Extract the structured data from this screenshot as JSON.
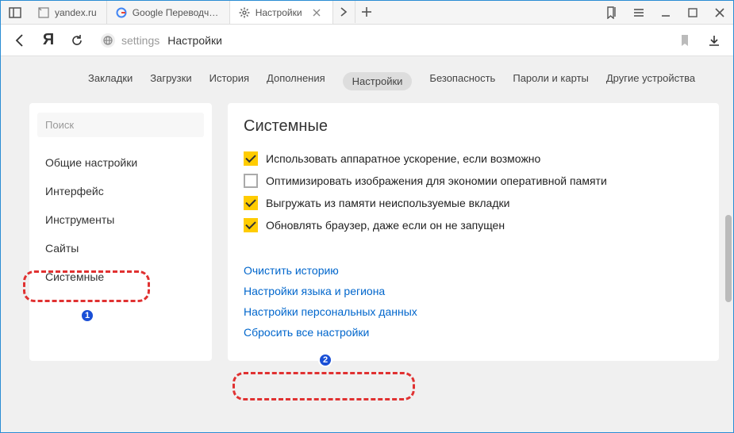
{
  "titlebar": {
    "tabs": [
      {
        "title": "yandex.ru",
        "favicon": "page"
      },
      {
        "title": "Google Переводчик - ",
        "favicon": "google"
      },
      {
        "title": "Настройки",
        "favicon": "gear",
        "active": true
      }
    ]
  },
  "addressbar": {
    "urlHint": "settings",
    "urlTitle": "Настройки"
  },
  "subnav": {
    "items": [
      "Закладки",
      "Загрузки",
      "История",
      "Дополнения",
      "Настройки",
      "Безопасность",
      "Пароли и карты",
      "Другие устройства"
    ],
    "activeIndex": 4
  },
  "sidebar": {
    "searchPlaceholder": "Поиск",
    "items": [
      "Общие настройки",
      "Интерфейс",
      "Инструменты",
      "Сайты",
      "Системные"
    ],
    "activeIndex": 4
  },
  "main": {
    "heading": "Системные",
    "options": [
      {
        "label": "Использовать аппаратное ускорение, если возможно",
        "checked": true
      },
      {
        "label": "Оптимизировать изображения для экономии оперативной памяти",
        "checked": false
      },
      {
        "label": "Выгружать из памяти неиспользуемые вкладки",
        "checked": true
      },
      {
        "label": "Обновлять браузер, даже если он не запущен",
        "checked": true
      }
    ],
    "links": [
      "Очистить историю",
      "Настройки языка и региона",
      "Настройки персональных данных",
      "Сбросить все настройки"
    ]
  },
  "annotations": {
    "badge1": "1",
    "badge2": "2"
  }
}
